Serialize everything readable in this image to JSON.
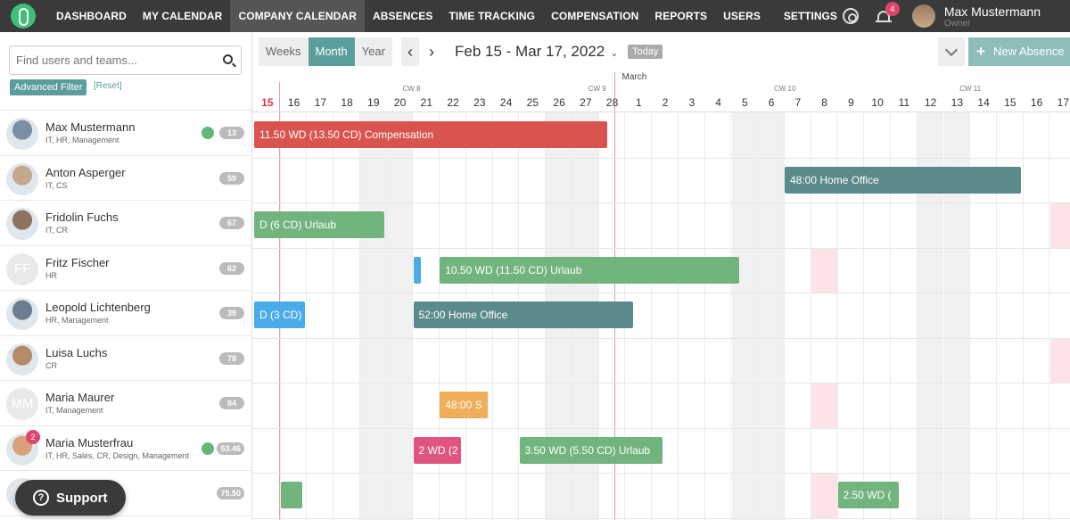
{
  "nav": {
    "items": [
      "DASHBOARD",
      "MY CALENDAR",
      "COMPANY CALENDAR",
      "ABSENCES",
      "TIME TRACKING",
      "COMPENSATION",
      "REPORTS",
      "USERS"
    ],
    "active": "COMPANY CALENDAR",
    "settings_label": "SETTINGS",
    "notification_count": "4",
    "user_name": "Max Mustermann",
    "user_role": "Owner"
  },
  "sidebar": {
    "search_placeholder": "Find users and teams...",
    "advanced_filter": "Advanced Filter",
    "reset": "[Reset]",
    "people": [
      {
        "name": "Max Mustermann",
        "teams": "IT, HR, Management",
        "count": "13",
        "online": true,
        "avatar": "photo"
      },
      {
        "name": "Anton Asperger",
        "teams": "IT, CS",
        "count": "59",
        "online": false,
        "avatar": "photo"
      },
      {
        "name": "Fridolin Fuchs",
        "teams": "IT, CR",
        "count": "67",
        "online": false,
        "avatar": "photo"
      },
      {
        "name": "Fritz Fischer",
        "teams": "HR",
        "count": "62",
        "online": false,
        "avatar": "FF"
      },
      {
        "name": "Leopold Lichtenberg",
        "teams": "HR, Management",
        "count": "39",
        "online": false,
        "avatar": "photo"
      },
      {
        "name": "Luisa Luchs",
        "teams": "CR",
        "count": "78",
        "online": false,
        "avatar": "photo"
      },
      {
        "name": "Maria Maurer",
        "teams": "IT, Management",
        "count": "84",
        "online": false,
        "avatar": "MM"
      },
      {
        "name": "Maria Musterfrau",
        "teams": "IT, HR, Sales, CR, Design, Management",
        "count": "53.46",
        "online": true,
        "avatar": "photo",
        "badge": "2"
      },
      {
        "name": "",
        "teams": "",
        "count": "75.50",
        "online": false,
        "avatar": "photo"
      }
    ],
    "support_label": "Support"
  },
  "toolbar": {
    "views": [
      "Weeks",
      "Month",
      "Year"
    ],
    "active_view": "Month",
    "date_range": "Feb 15 - Mar 17, 2022",
    "today_label": "Today",
    "new_absence_label": "New Absence"
  },
  "calendar": {
    "month_label": "March",
    "calendar_weeks": [
      {
        "label": "CW 8",
        "day": "21"
      },
      {
        "label": "CW 9",
        "day": "28"
      },
      {
        "label": "CW 10",
        "day": "7"
      },
      {
        "label": "CW 11",
        "day": "14"
      }
    ],
    "days": [
      "15",
      "16",
      "17",
      "18",
      "19",
      "20",
      "21",
      "22",
      "23",
      "24",
      "25",
      "26",
      "27",
      "28",
      "1",
      "2",
      "3",
      "4",
      "5",
      "6",
      "7",
      "8",
      "9",
      "10",
      "11",
      "12",
      "13",
      "14",
      "15",
      "16",
      "17"
    ],
    "today_index": 0,
    "weekend_indices": [
      4,
      5,
      11,
      12,
      18,
      19,
      25,
      26
    ],
    "absences": [
      {
        "row": 0,
        "label": "11.50 WD (13.50 CD) Compensation",
        "start": 0,
        "end": 13.3,
        "color": "#d9534f"
      },
      {
        "row": 1,
        "label": "48:00 Home Office",
        "start": 20,
        "end": 28.9,
        "color": "#5a8a8c"
      },
      {
        "row": 2,
        "label": "D (6 CD) Urlaub",
        "start": 0,
        "end": 4.9,
        "color": "#72b47e"
      },
      {
        "row": 3,
        "label": "",
        "start": 6,
        "end": 6.3,
        "color": "#4aabea"
      },
      {
        "row": 3,
        "label": "10.50 WD (11.50 CD) Urlaub",
        "start": 7,
        "end": 18.3,
        "color": "#72b47e"
      },
      {
        "row": 4,
        "label": "D (3 CD)",
        "start": 0,
        "end": 1.9,
        "color": "#4aabea"
      },
      {
        "row": 4,
        "label": "52:00 Home Office",
        "start": 6,
        "end": 14.3,
        "color": "#5a8a8c"
      },
      {
        "row": 6,
        "label": "48:00 S",
        "start": 7,
        "end": 8.8,
        "color": "#f0ad5a"
      },
      {
        "row": 7,
        "label": "2 WD (2",
        "start": 6,
        "end": 7.8,
        "color": "#e05580"
      },
      {
        "row": 7,
        "label": "3.50 WD (5.50 CD) Urlaub",
        "start": 10,
        "end": 15.4,
        "color": "#72b47e"
      },
      {
        "row": 8,
        "label": "",
        "start": 1,
        "end": 1.8,
        "color": "#72b47e"
      },
      {
        "row": 8,
        "label": "2.50 WD (",
        "start": 22,
        "end": 24.3,
        "color": "#72b47e"
      }
    ],
    "holiday_cells": [
      {
        "row": 3,
        "col": 21
      },
      {
        "row": 5,
        "col": 30
      },
      {
        "row": 6,
        "col": 21
      },
      {
        "row": 8,
        "col": 21
      },
      {
        "row": 2,
        "col": 30
      }
    ]
  }
}
